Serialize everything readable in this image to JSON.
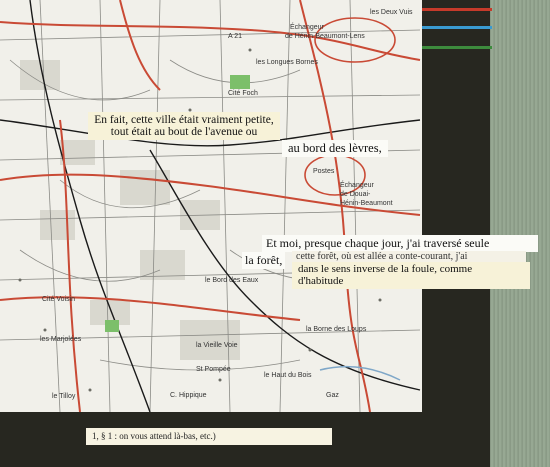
{
  "colors": {
    "map_bg": "#f1f0ea",
    "road_red": "#c94a35",
    "stripe_green": "#3d8b3d",
    "stripe_blue": "#3a9bd1",
    "stripe_red": "#c63a2a",
    "panel_green": "#93a48f",
    "dark_bg": "#272720"
  },
  "collage": {
    "line1": "En fait, cette ville était vraiment petite,",
    "line2": "tout était au bout de l'avenue ou",
    "line3": "au bord des lèvres,",
    "line4": "Et moi, presque chaque jour, j'ai traversé seule",
    "line5": "la forêt,",
    "line5_over": "cette forêt, où est allée a conte-courant, j'ai",
    "line6a": "dans le sens inverse de la foule, comme",
    "line6b": "d'habitude",
    "footnote": "1, § 1 : on vous attend là-bas, etc.)"
  },
  "map_labels": {
    "a21": "A 21",
    "echangeur": "Échangeur",
    "henin": "de Hénin-Beaumont-Lens",
    "longues": "les Longues Bornes",
    "deux_visins": "les Deux Vuis",
    "cite_foch": "Cité Foch",
    "postes": "Postes",
    "echangeur2": "Échangeur",
    "douai": "de Douai-",
    "henin2": "Hénin-Beaumont",
    "bord_eaux": "le Bord des Eaux",
    "borne_loups": "la Borne des Loups",
    "vieille_voie": "la Vieille Voie",
    "haut_bois": "le Haut du Bois",
    "st_pompee": "St Pompée",
    "tilloy": "le Tilloy",
    "marjolees": "les Marjolées",
    "cite_voisin": "Cité Voisin",
    "hippique": "C. Hippique",
    "gaz": "Gaz"
  }
}
